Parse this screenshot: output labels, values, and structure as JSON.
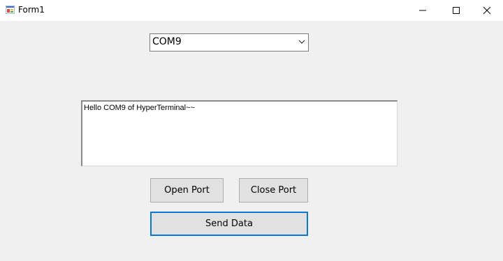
{
  "window": {
    "title": "Form1",
    "icons": {
      "app": "form-app-icon",
      "minimize": "minimize-icon",
      "maximize": "maximize-icon",
      "close": "close-icon"
    }
  },
  "combo": {
    "value": "COM9",
    "arrow_icon": "chevron-down-icon"
  },
  "textbox": {
    "value": "Hello COM9 of HyperTerminal~~"
  },
  "buttons": {
    "open_port": "Open Port",
    "close_port": "Close Port",
    "send_data": "Send Data"
  },
  "colors": {
    "background": "#f0f0f0",
    "button": "#e1e1e1",
    "focus_border": "#0078d7"
  }
}
